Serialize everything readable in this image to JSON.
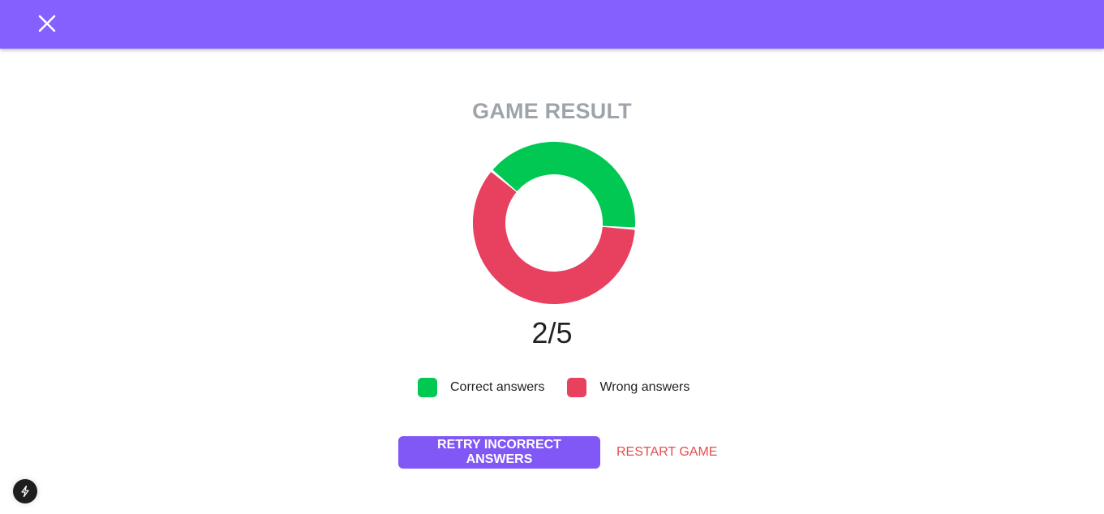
{
  "header": {
    "close_icon": "close-icon",
    "background": "#8560ff"
  },
  "result": {
    "title": "GAME RESULT",
    "score_text": "2/5"
  },
  "chart_data": {
    "type": "pie",
    "categories": [
      "Correct answers",
      "Wrong answers"
    ],
    "values": [
      2,
      3
    ],
    "colors": [
      "#00c853",
      "#e8405f"
    ],
    "donut": true
  },
  "legend": {
    "correct_label": "Correct answers",
    "wrong_label": "Wrong answers",
    "correct_color": "#00c853",
    "wrong_color": "#e8405f"
  },
  "actions": {
    "retry_label": "RETRY INCORRECT ANSWERS",
    "restart_label": "RESTART GAME"
  },
  "floating": {
    "icon": "lightning-icon"
  }
}
